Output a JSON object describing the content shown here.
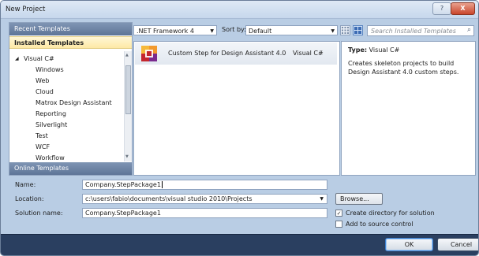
{
  "window": {
    "title": "New Project",
    "help_label": "?",
    "close_label": "X"
  },
  "nav": {
    "recent": "Recent Templates",
    "installed": "Installed Templates",
    "tree_root": "Visual C#",
    "tree_items": [
      "Windows",
      "Web",
      "Cloud",
      "Matrox Design Assistant",
      "Reporting",
      "Silverlight",
      "Test",
      "WCF",
      "Workflow"
    ],
    "online": "Online Templates"
  },
  "toolbar": {
    "framework": ".NET Framework 4",
    "sort_label": "Sort by:",
    "sort_value": "Default",
    "search_placeholder": "Search Installed Templates"
  },
  "templates": [
    {
      "name": "Custom Step for Design Assistant 4.0",
      "language": "Visual C#"
    }
  ],
  "details": {
    "type_label": "Type:",
    "type_value": "Visual C#",
    "description": "Creates skeleton projects to build Design Assistant 4.0 custom steps."
  },
  "form": {
    "name_label": "Name:",
    "name_value": "Company.StepPackage1",
    "location_label": "Location:",
    "location_value": "c:\\users\\fabio\\documents\\visual studio 2010\\Projects",
    "solution_label": "Solution name:",
    "solution_value": "Company.StepPackage1",
    "browse_label": "Browse...",
    "create_dir_label": "Create directory for solution",
    "create_dir_checked": true,
    "source_control_label": "Add to source control",
    "source_control_checked": false
  },
  "buttons": {
    "ok": "OK",
    "cancel": "Cancel"
  }
}
